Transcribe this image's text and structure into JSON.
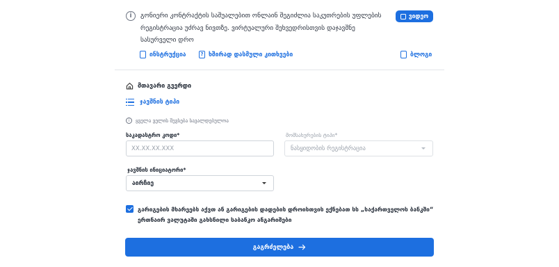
{
  "info": {
    "text": "გონიერი კონტრაქტის საშუალებით ონლაინ შეგიძლია საკუთრების უფლების რეგისტრაცია უძრავ ნივთზე. ვირტუალური შეხვედრისთვის დაჯავშნე სასურველი დრო",
    "video_label": "ვიდეო"
  },
  "links": {
    "instruction": "ინსტრუქცია",
    "faq": "ხშირად დასმული კითხვები",
    "blog": "ბლოგი",
    "faq_icon_glyph": "?"
  },
  "nav": {
    "home": "მთავარი გვერდი",
    "type": "ჯავშნის ტიპი"
  },
  "form": {
    "required_note": "ყველა ველის შევსება სავალდებულოა",
    "cadastral_label": "საკადასტრო კოდი*",
    "cadastral_placeholder": "XX.XX.XX.XXX",
    "service_label": "მომსახურების ტიპი*",
    "service_value": "ნასყიდობის რეგისტრაცია",
    "initiator_label": "ჯავშნის ინიციატორი*",
    "initiator_value": "აირჩიე"
  },
  "consent": {
    "checked": true,
    "text": "გარიგების მხარეებს აქვთ ან გარიგების დადების დროისთვის ექნებათ სს „საქართველოს ბანკში“ ერთნაირ ვალუტაში გახსნილი საბანკო ანგარიშები"
  },
  "continue_label": "გაგრძელება",
  "colors": {
    "accent": "#1d6fe0",
    "text": "#1f2733",
    "muted": "#9aa1ab",
    "border": "#cfd4da"
  },
  "icons": {
    "info": "info-circle-icon",
    "video": "video-icon",
    "instruction": "document-icon",
    "faq": "question-icon",
    "blog": "blog-icon",
    "home": "home-icon",
    "type": "list-icon",
    "note": "info-small-icon",
    "arrow": "arrow-right-icon"
  }
}
